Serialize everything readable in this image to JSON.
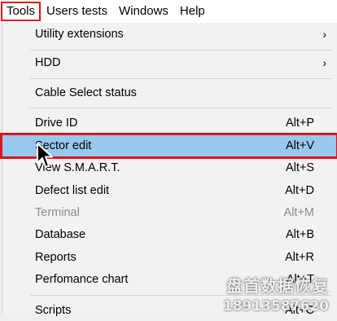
{
  "menubar": {
    "items": [
      {
        "label": "Tools"
      },
      {
        "label": "Users tests"
      },
      {
        "label": "Windows"
      },
      {
        "label": "Help"
      }
    ]
  },
  "menu": {
    "utility_extensions": {
      "label": "Utility extensions",
      "submenu_glyph": "›"
    },
    "hdd": {
      "label": "HDD",
      "submenu_glyph": "›"
    },
    "cable_select": {
      "label": "Cable Select status"
    },
    "drive_id": {
      "label": "Drive ID",
      "shortcut": "Alt+P"
    },
    "sector_edit": {
      "label": "Sector edit",
      "shortcut": "Alt+V"
    },
    "view_smart": {
      "label": "View S.M.A.R.T.",
      "shortcut": "Alt+S"
    },
    "defect_list": {
      "label": "Defect list edit",
      "shortcut": "Alt+D"
    },
    "terminal": {
      "label": "Terminal",
      "shortcut": "Alt+M"
    },
    "database": {
      "label": "Database",
      "shortcut": "Alt+B"
    },
    "reports": {
      "label": "Reports",
      "shortcut": "Alt+R"
    },
    "performance_chart": {
      "label": "Perfomance chart",
      "shortcut": "Alt+T"
    },
    "scripts": {
      "label": "Scripts",
      "shortcut": "Alt+C"
    }
  },
  "watermark": {
    "line1": "盘首数据恢复",
    "line2": "18913587620"
  },
  "colors": {
    "highlight": "#98c8ee",
    "annotation_red": "#d9151c",
    "menu_bg": "#f2f2f2"
  }
}
